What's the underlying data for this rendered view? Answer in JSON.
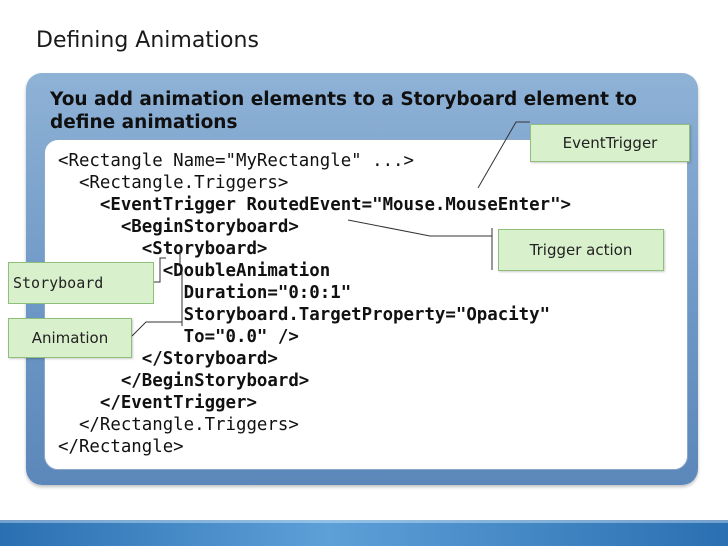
{
  "slide": {
    "title": "Defining Animations",
    "lead": "You add animation elements to a Storyboard element to define animations"
  },
  "code": {
    "lines": [
      "<Rectangle Name=\"MyRectangle\" ...>",
      "  <Rectangle.Triggers>",
      "    <EventTrigger RoutedEvent=\"Mouse.MouseEnter\">",
      "      <BeginStoryboard>",
      "        <Storyboard>",
      "          <DoubleAnimation",
      "            Duration=\"0:0:1\"",
      "            Storyboard.TargetProperty=\"Opacity\"",
      "            To=\"0.0\" />",
      "        </Storyboard>",
      "      </BeginStoryboard>",
      "    </EventTrigger>",
      "  </Rectangle.Triggers>",
      "</Rectangle>"
    ]
  },
  "callouts": {
    "event_trigger": "EventTrigger",
    "trigger_action": "Trigger action",
    "storyboard": "Storyboard",
    "animation": "Animation"
  },
  "colors": {
    "panel": "#6e98c6",
    "callout_fill": "#d9f0cc",
    "band": "#2a6fb1"
  }
}
